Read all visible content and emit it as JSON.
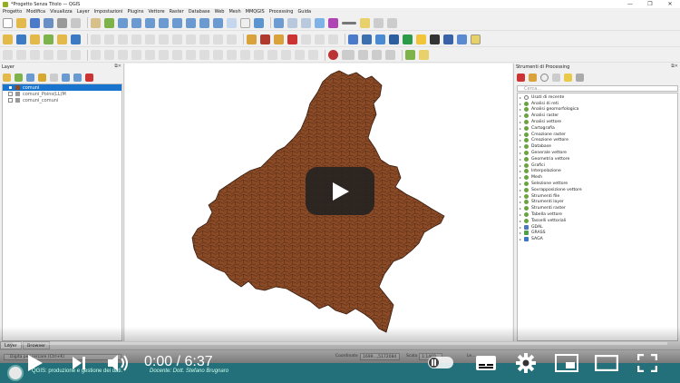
{
  "window": {
    "title": "*Progetto Senza Titolo — QGIS",
    "controls": [
      "—",
      "❐",
      "✕"
    ]
  },
  "menu": [
    "Progetto",
    "Modifica",
    "Visualizza",
    "Layer",
    "Impostazioni",
    "Plugins",
    "Vettore",
    "Raster",
    "Database",
    "Web",
    "Mesh",
    "MMQGIS",
    "Processing",
    "Guida"
  ],
  "layers_panel": {
    "title": "Layer",
    "items": [
      {
        "label": "comuni",
        "checked": true,
        "selected": true
      },
      {
        "label": "comuni_Poins(LL)M",
        "checked": false,
        "selected": false
      },
      {
        "label": "comuni_comuni",
        "checked": false,
        "selected": false
      }
    ]
  },
  "processing_panel": {
    "title": "Strumenti di Processing",
    "search_placeholder": "Cerca...",
    "items": [
      "Usati di recente",
      "Analisi di reti",
      "Analisi geomorfologica",
      "Analisi raster",
      "Analisi vettore",
      "Cartografia",
      "Creazione raster",
      "Creazione vettore",
      "Database",
      "Generale vettore",
      "Geometria vettore",
      "Grafici",
      "Interpolazione",
      "Mesh",
      "Selezione vettore",
      "Sovrapposizione vettore",
      "Strumenti file",
      "Strumenti layer",
      "Strumenti raster",
      "Tabella vettore",
      "Tasselli vettoriali",
      "GDAL",
      "GRASS",
      "SAGA"
    ]
  },
  "tabs": [
    "Layer",
    "Browser"
  ],
  "status": {
    "search_placeholder": "Digita per cercare (Ctrl+K)",
    "coord_label": "Coordinate",
    "coord_value": "1699...,5172084",
    "scale_label": "Scala",
    "scale_value": "1:1469...",
    "extra_label": "Le..."
  },
  "map": {
    "fill_color": "#8b4a26",
    "stroke_color": "#3a1e10"
  },
  "video": {
    "time_current": "0:00",
    "time_separator": " / ",
    "time_total": "6:37",
    "progress": 0,
    "caption_title": "QGIS: produzione e gestione dei dati.",
    "caption_author": "Docente: Dott. Stefano Brugnaro",
    "accent_color": "#ff0000",
    "icons": [
      "play-icon",
      "next-icon",
      "volume-icon",
      "autoplay-toggle",
      "subtitles-icon",
      "settings-icon",
      "miniplayer-icon",
      "theater-icon",
      "fullscreen-icon"
    ]
  }
}
